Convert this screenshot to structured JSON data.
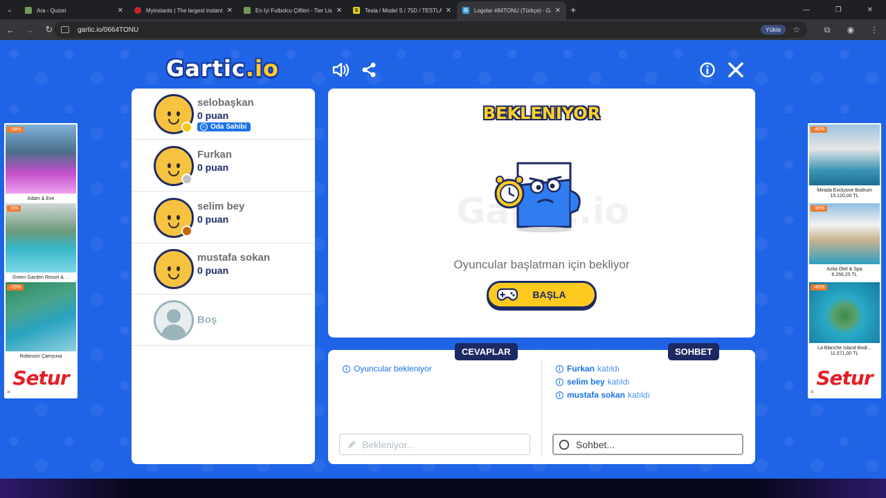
{
  "browser": {
    "tabs": [
      {
        "title": "Ara - Quizei",
        "favicon_color": "#6f9a5a"
      },
      {
        "title": "Myinstants | The largest instant",
        "favicon_color": "#c0262d"
      },
      {
        "title": "En İyi Futbolcu Çiftleri - Tier Lis",
        "favicon_color": "#6f9a5a"
      },
      {
        "title": "Tesla / Model S / 75D / TESTLA",
        "favicon_color": "#e3d11c",
        "favicon_glyph": "S"
      },
      {
        "title": "Logolar #84TONU (Türkçe) - Ga",
        "favicon_color": "#3aa0dd",
        "favicon_glyph": "G",
        "active": true
      }
    ],
    "url": "gartic.io/0664TONU",
    "upload_label": "Yükle"
  },
  "game": {
    "logo_text": "Gartic",
    "logo_suffix": ".io",
    "players": [
      {
        "name": "selobaşkan",
        "score": "0 puan",
        "badge": "Oda Sahibi",
        "dot_color": "#f5c518"
      },
      {
        "name": "Furkan",
        "score": "0 puan",
        "dot_color": "#c2c2c2"
      },
      {
        "name": "selim bey",
        "score": "0 puan",
        "dot_color": "#c8640f"
      },
      {
        "name": "mustafa sokan",
        "score": "0 puan",
        "dot_color": ""
      }
    ],
    "empty_slot": "Boş",
    "status_title": "BEKLENIYOR",
    "watermark": "Gartic.io",
    "wait_message": "Oyuncular başlatman için bekliyor",
    "start_button": "BAŞLA",
    "answers_label": "CEVAPLAR",
    "chat_label": "SOHBET",
    "answers_messages": [
      {
        "text": "Oyuncular bekleniyor"
      }
    ],
    "chat_messages": [
      {
        "name": "Furkan",
        "text": "katıldı"
      },
      {
        "name": "selim bey",
        "text": "katıldı"
      },
      {
        "name": "mustafa sokan",
        "text": "katıldı"
      }
    ],
    "answer_placeholder": "Bekleniyor...",
    "chat_placeholder": "Sohbet..."
  },
  "ads": {
    "left": {
      "items": [
        {
          "discount": "-38%",
          "name": "Adam & Eve"
        },
        {
          "discount": "-5%",
          "name": "Green Garden Resort & ..."
        },
        {
          "discount": "-15%",
          "name": "Robinson Çamyuva"
        }
      ],
      "brand": "Setur"
    },
    "right": {
      "items": [
        {
          "discount": "-40%",
          "name": "Mirada Exclusive Bodrum",
          "price": "15.120,00 TL"
        },
        {
          "discount": "-35%",
          "name": "Azka Otel & Spa",
          "price": "6.256,25 TL"
        },
        {
          "discount": "-45%",
          "name": "La Blanche Island Bodr...",
          "price": "11.571,00 TL"
        }
      ],
      "brand": "Setur"
    }
  },
  "colors": {
    "background": "#1f63e6",
    "navy": "#1c2a63",
    "accent_yellow": "#ffca1f",
    "link_blue": "#1a72e8"
  }
}
